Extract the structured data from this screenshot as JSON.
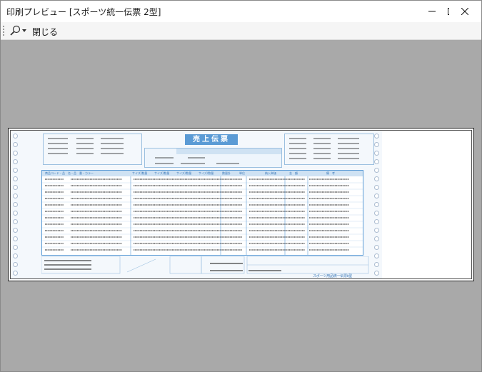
{
  "window": {
    "title": "印刷プレビュー [スポーツ統一伝票 2型]",
    "controls": {
      "minimize_icon": "minimize-icon",
      "maximize_icon": "maximize-icon",
      "close_icon": "close-icon"
    }
  },
  "toolbar": {
    "zoom_icon": "magnifier-icon",
    "close_label": "閉じる"
  },
  "preview": {
    "slip_title": "売上伝票",
    "column_headers": [
      "商品コード・品　名・品　番・カラー",
      "サイズ/数量",
      "サイズ/数量",
      "サイズ/数量",
      "サイズ/数量",
      "数量計",
      "単位",
      "納入単価",
      "金　額",
      "備　考"
    ],
    "footer_right": "スポーツ用品統一伝票Ⅱ型"
  }
}
